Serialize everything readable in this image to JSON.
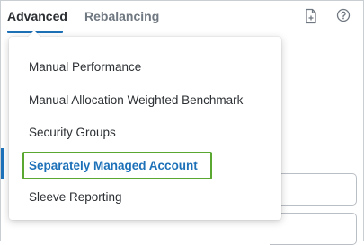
{
  "tabs": [
    {
      "label": "Advanced",
      "active": true
    },
    {
      "label": "Rebalancing",
      "active": false
    }
  ],
  "icons": {
    "document": "add-document-icon",
    "help": "help-circle-icon"
  },
  "menu": {
    "items": [
      {
        "label": "Manual Performance"
      },
      {
        "label": "Manual Allocation Weighted Benchmark"
      },
      {
        "label": "Security Groups"
      },
      {
        "label": "Separately Managed Account",
        "selected": true
      },
      {
        "label": "Sleeve Reporting"
      }
    ]
  },
  "colors": {
    "accent": "#1d71b8",
    "highlight": "#5aa832",
    "text": "#2b2f33",
    "muted": "#6f7780"
  }
}
